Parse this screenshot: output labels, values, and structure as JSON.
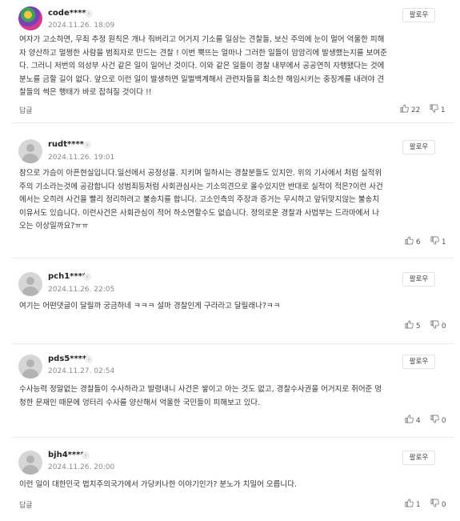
{
  "ui": {
    "follow_label": "팔로우",
    "reply_label": "답글",
    "chevron_glyph": "›"
  },
  "comments": [
    {
      "nick": "code****",
      "date": "2024.11.26. 18:09",
      "text": "여자가 고소하면, 무죄 추정 원칙은 개나 줘버리고 어거지 기소를 일삼는 견찰들, 보신 주의에 눈이 멀어 억울한 피해\n자 양산하고 멀쩡한 사람을 범죄자로 만드는 견찰 ! 이번 뿍뜨는 얼마나 그러한 일들이 암암리에 발생했는지를 보여준\n다. 그러니 저번의 의성부 사건 같은 일이 일어난 것이다. 이와 같은 일들이 경찰 내부에서 공공연히 자행됐다는 것에\n분노를 금할 길이 없다. 앞으로 이런 일이 발생하면 일벌백계해서 관련자들을 최소한 해임시키는 중징계를 내려야 견\n찰들의 썩은 행태가 바로 잡혀질 것이다 !!",
      "likes": "22",
      "dislikes": "1"
    },
    {
      "nick": "rudt****",
      "date": "2024.11.26. 19:01",
      "text": "참으로 가슴이 아픈현실입니다.일선에서 공정성을. 지키며 일하시는 경찰분들도 있지만. 위의 기사에서 처럼 실적위\n주의 기소라는것에 공감합니다 성범죄등처럼 사회관심사는 기소의견으로 올수있지만 반대로 실적이 적은?이런 사건\n에서는 오히려 사건을 빨리 정리하려고 불송치를 합니다. 고소인측의 주장과 증거는 무시하고 앞뒤맞지않는 불송치\n이유서도 있습니다. 이런사건은 사회관심이 적어 하소연할수도 없습니다. 정의로운 경찰과 사법부는 드라마에서 나\n오는 이상일까요?ㅠㅠ",
      "likes": "6",
      "dislikes": "1"
    },
    {
      "nick": "pch1****",
      "date": "2024.11.26. 22:05",
      "text": "여기는 어떤댓글이 달릴까 궁금하네 ㅋㅋㅋ 설마 경찰인게 구라라고 달릴래나?ㅋㅋ",
      "likes": "5",
      "dislikes": "0"
    },
    {
      "nick": "pds5****",
      "date": "2024.11.27. 02:54",
      "text": "수사능력 정말없는 경찰들이 수사하라고 발령내니 사건은 쌓이고 아는 것도 없고, 경찰수사권을 어거지로 쥐어준 멍\n청한 문재인 때문에 엉터리 수사를 양산해서 억울한 국민들이 피해보고 있다.",
      "likes": "4",
      "dislikes": "0"
    },
    {
      "nick": "bjh4****",
      "date": "2024.11.26. 20:00",
      "text": "이런 일이 대한민국 법치주의국가에서 가당키나한 이야기인가? 분노가 치밀어 오릅니다.",
      "likes": "1",
      "dislikes": "0"
    }
  ]
}
